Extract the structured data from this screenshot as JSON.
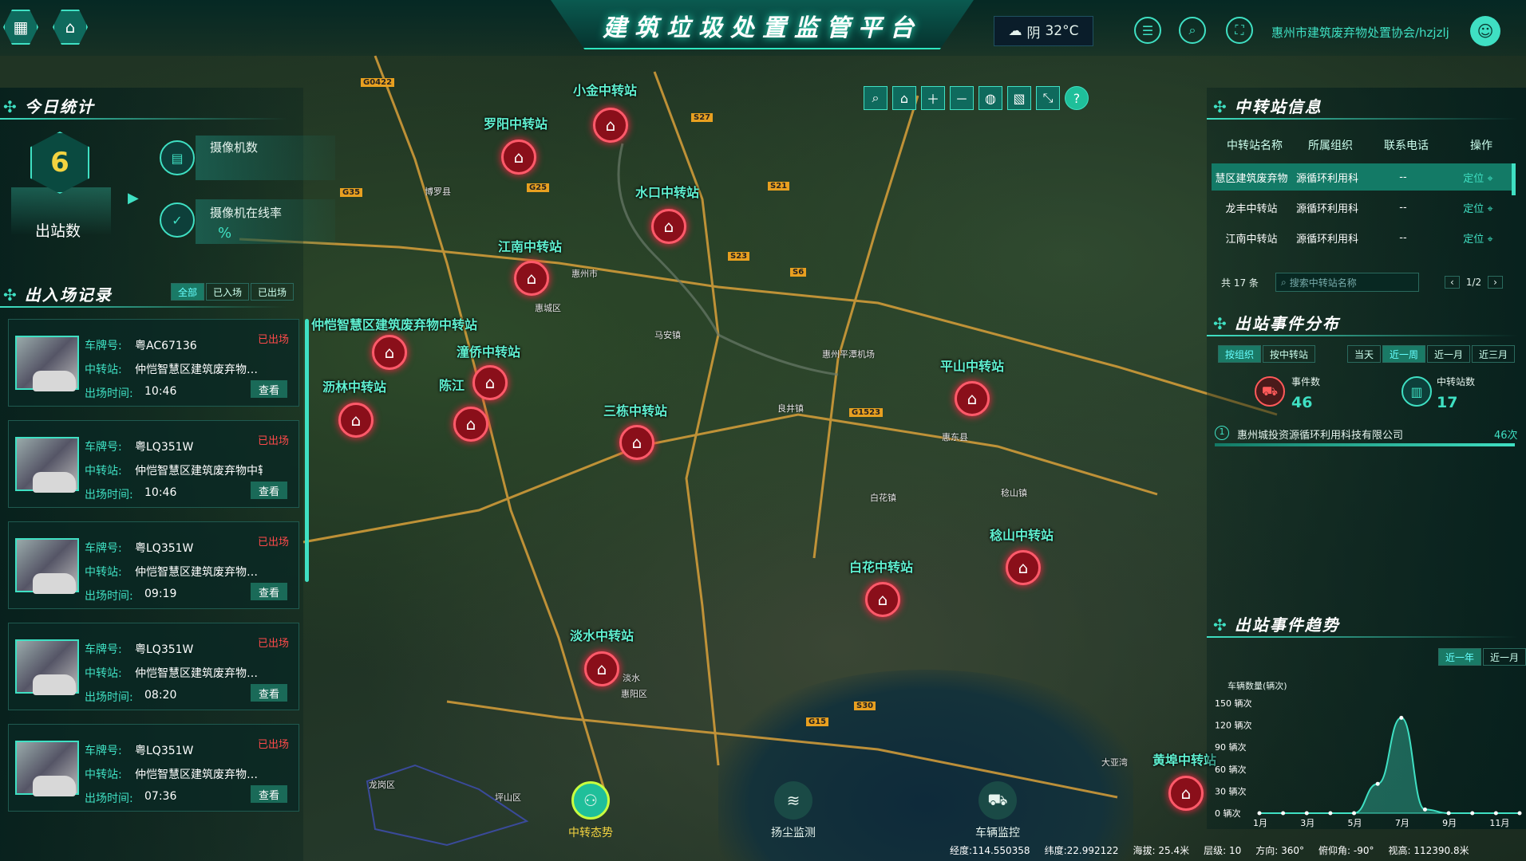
{
  "app": {
    "title": "建筑垃圾处置监管平台"
  },
  "header": {
    "weather_icon": "cloud-icon",
    "weather_text": "阴",
    "temperature": "32°C",
    "user": "惠州市建筑废弃物处置协会/hzjzlj"
  },
  "today_stats": {
    "title": "今日统计",
    "count": "6",
    "count_label": "出站数",
    "camera_count_label": "摄像机数",
    "camera_online_label": "摄像机在线率",
    "camera_online_value": "%"
  },
  "records": {
    "title": "出入场记录",
    "filters": [
      "全部",
      "已入场",
      "已出场"
    ],
    "plate_label": "车牌号:",
    "station_label": "中转站:",
    "time_label": "出场时间:",
    "view_label": "查看",
    "items": [
      {
        "plate": "粤AC67136",
        "station": "仲恺智慧区建筑废弃物…",
        "time": "10:46",
        "status": "已出场"
      },
      {
        "plate": "粤LQ351W",
        "station": "仲恺智慧区建筑废弃物中转站",
        "time": "10:46",
        "status": "已出场"
      },
      {
        "plate": "粤LQ351W",
        "station": "仲恺智慧区建筑废弃物…",
        "time": "09:19",
        "status": "已出场"
      },
      {
        "plate": "粤LQ351W",
        "station": "仲恺智慧区建筑废弃物…",
        "time": "08:20",
        "status": "已出场"
      },
      {
        "plate": "粤LQ351W",
        "station": "仲恺智慧区建筑废弃物…",
        "time": "07:36",
        "status": "已出场"
      }
    ]
  },
  "map": {
    "stations": [
      "小金中转站",
      "罗阳中转站",
      "水口中转站",
      "江南中转站",
      "仲恺智慧区建筑废弃物中转站",
      "潼侨中转站",
      "沥林中转站",
      "陈江",
      "三栋中转站",
      "平山中转站",
      "稔山中转站",
      "白花中转站",
      "淡水中转站",
      "黄埠中转站"
    ],
    "places": [
      "惠州市",
      "惠州平潭机场",
      "惠城区",
      "惠阳区",
      "惠东县",
      "博罗县",
      "龙岗区",
      "坪山区",
      "马安镇",
      "良井镇",
      "白花镇",
      "稔山镇",
      "大亚湾",
      "淡水"
    ],
    "roads": [
      "G25",
      "G15",
      "G35",
      "G0422",
      "S27",
      "S21",
      "S23",
      "S6",
      "S30",
      "G1523"
    ]
  },
  "map_tools": [
    "search-icon",
    "home-icon",
    "zoom-in-icon",
    "zoom-out-icon",
    "globe-icon",
    "layer-icon",
    "fullscreen-icon",
    "help-icon"
  ],
  "station_info": {
    "title": "中转站信息",
    "columns": [
      "中转站名称",
      "所属组织",
      "联系电话",
      "操作"
    ],
    "rows": [
      {
        "name": "慧区建筑废弃物",
        "org": "源循环利用科",
        "phone": "--",
        "action": "定位"
      },
      {
        "name": "龙丰中转站",
        "org": "源循环利用科",
        "phone": "--",
        "action": "定位"
      },
      {
        "name": "江南中转站",
        "org": "源循环利用科",
        "phone": "--",
        "action": "定位"
      }
    ],
    "total": "共 17 条",
    "search_placeholder": "搜索中转站名称",
    "page": "1/2"
  },
  "events": {
    "title": "出站事件分布",
    "tabs": [
      "按组织",
      "按中转站"
    ],
    "ranges": [
      "当天",
      "近一周",
      "近一月",
      "近三月"
    ],
    "event_label": "事件数",
    "event_value": "46",
    "station_label": "中转站数",
    "station_value": "17",
    "rank": [
      {
        "no": "1",
        "name": "惠州城投资源循环利用科技有限公司",
        "value": "46次"
      }
    ]
  },
  "trend": {
    "title": "出站事件趋势",
    "ranges": [
      "近一年",
      "近一月"
    ]
  },
  "chart_data": {
    "type": "area",
    "title": "",
    "ylabel": "车辆数量(辆次)",
    "ylim": [
      0,
      150
    ],
    "yticks": [
      "150 辆次",
      "120 辆次",
      "90 辆次",
      "60 辆次",
      "30 辆次",
      "0 辆次"
    ],
    "xticks": [
      "1月",
      "3月",
      "5月",
      "7月",
      "9月",
      "11月"
    ],
    "x": [
      "1月",
      "2月",
      "3月",
      "4月",
      "5月",
      "6月",
      "7月",
      "8月",
      "9月",
      "10月",
      "11月",
      "12月"
    ],
    "series": [
      {
        "values": [
          0,
          0,
          0,
          0,
          0,
          40,
          130,
          5,
          0,
          0,
          0,
          0
        ]
      }
    ]
  },
  "bottom_nav": [
    "中转态势",
    "扬尘监测",
    "车辆监控"
  ],
  "status": {
    "lng": "经度:114.550358",
    "lat": "纬度:22.992122",
    "alt": "海拔: 25.4米",
    "level": "层级: 10",
    "dir": "方向: 360°",
    "pitch": "俯仰角: -90°",
    "height": "视高: 112390.8米"
  },
  "colors": {
    "accent": "#3fe0c3",
    "marker": "#8a0f1a",
    "alert": "#ff4a4a"
  }
}
